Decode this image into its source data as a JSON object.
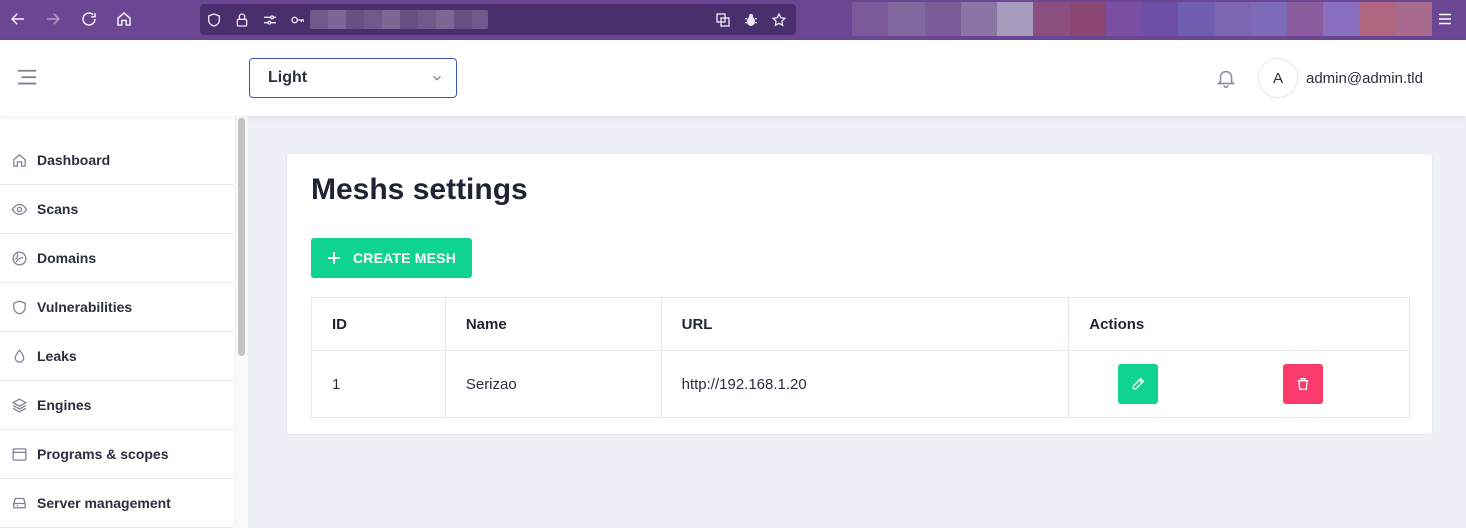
{
  "colors": {
    "browser_bar": "#6a4693",
    "accent_green": "#0fd48f",
    "danger_pink": "#fb3a6e",
    "select_border": "#3c59b8",
    "background": "#eef0f7"
  },
  "browser": {
    "icons": [
      "back-icon",
      "forward-icon",
      "reload-icon",
      "home-icon",
      "shield-icon",
      "lock-icon",
      "permissions-icon",
      "key-icon",
      "translate-icon",
      "bug-icon",
      "star-icon",
      "menu-icon"
    ]
  },
  "header": {
    "theme_select": {
      "value": "Light"
    },
    "avatar_letter": "A",
    "user_email": "admin@admin.tld"
  },
  "sidebar": {
    "items": [
      {
        "label": "Dashboard",
        "icon": "home-icon"
      },
      {
        "label": "Scans",
        "icon": "eye-icon"
      },
      {
        "label": "Domains",
        "icon": "globe-icon"
      },
      {
        "label": "Vulnerabilities",
        "icon": "shield-icon"
      },
      {
        "label": "Leaks",
        "icon": "drop-icon"
      },
      {
        "label": "Engines",
        "icon": "layers-icon"
      },
      {
        "label": "Programs & scopes",
        "icon": "calendar-icon"
      },
      {
        "label": "Server management",
        "icon": "server-icon"
      }
    ]
  },
  "main": {
    "title": "Meshs settings",
    "create_button": "CREATE MESH",
    "table": {
      "headers": [
        "ID",
        "Name",
        "URL",
        "Actions"
      ],
      "rows": [
        {
          "id": "1",
          "name": "Serizao",
          "url": "http://192.168.1.20"
        }
      ]
    }
  }
}
